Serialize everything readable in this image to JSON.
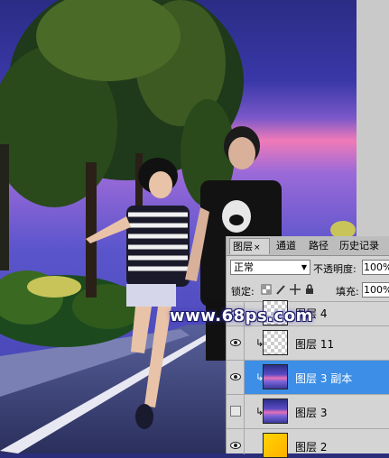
{
  "panel": {
    "tabs": [
      {
        "label": "图层",
        "close": "×"
      },
      {
        "label": "通道"
      },
      {
        "label": "路径"
      },
      {
        "label": "历史记录"
      }
    ],
    "blend_mode": "正常",
    "opacity_label": "不透明度:",
    "opacity_value": "100%",
    "lock_label": "锁定:",
    "fill_label": "填充:",
    "fill_value": "100%",
    "lock_icons": [
      "lock-transparent-icon",
      "lock-brush-icon",
      "lock-move-icon",
      "lock-all-icon"
    ],
    "layers": [
      {
        "name": "图层 4",
        "visible": true,
        "thumbnail": "checker"
      },
      {
        "name": "图层 11",
        "visible": true,
        "clipped": true,
        "thumbnail": "checker"
      },
      {
        "name": "图层 3 副本",
        "visible": true,
        "clipped": true,
        "selected": true,
        "thumbnail": "sky"
      },
      {
        "name": "图层 3",
        "visible": false,
        "clipped": true,
        "thumbnail": "sky"
      },
      {
        "name": "图层 2",
        "visible": true,
        "thumbnail": "yellow"
      }
    ]
  },
  "watermark": "www.68ps.com",
  "colors": {
    "selection": "#3d8ee6",
    "panel_bg": "#d4d4d4",
    "sky_top": "#2b2e86",
    "sky_pink": "#e56fb5"
  }
}
